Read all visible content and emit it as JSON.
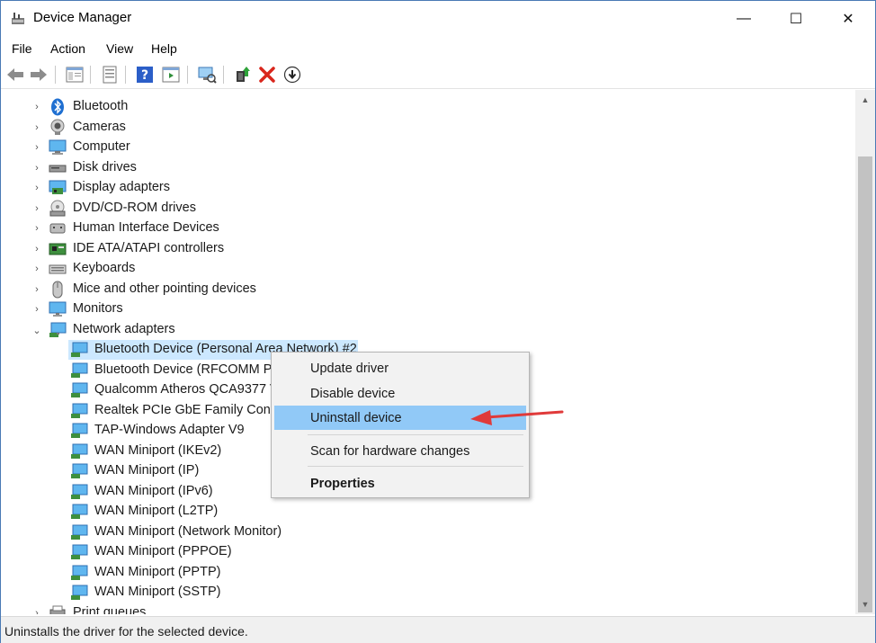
{
  "window": {
    "title": "Device Manager",
    "controls": [
      "—",
      "☐",
      "✕"
    ]
  },
  "menu": [
    "File",
    "Action",
    "View",
    "Help"
  ],
  "toolbar": {
    "icons": [
      "back-icon",
      "forward-icon",
      "show-hide-console-tree-icon",
      "properties-icon",
      "help-icon",
      "action-pane-icon",
      "scan-hardware-icon",
      "update-driver-icon",
      "uninstall-device-icon",
      "enable-device-icon"
    ],
    "uninstall_color": "#d9261c"
  },
  "tree": {
    "categories": [
      {
        "label": "Bluetooth",
        "icon": "bluetooth-icon"
      },
      {
        "label": "Cameras",
        "icon": "camera-icon"
      },
      {
        "label": "Computer",
        "icon": "computer-icon"
      },
      {
        "label": "Disk drives",
        "icon": "disk-drive-icon"
      },
      {
        "label": "Display adapters",
        "icon": "display-adapter-icon"
      },
      {
        "label": "DVD/CD-ROM drives",
        "icon": "dvd-drive-icon"
      },
      {
        "label": "Human Interface Devices",
        "icon": "hid-icon"
      },
      {
        "label": "IDE ATA/ATAPI controllers",
        "icon": "ide-controller-icon"
      },
      {
        "label": "Keyboards",
        "icon": "keyboard-icon"
      },
      {
        "label": "Mice and other pointing devices",
        "icon": "mouse-icon"
      },
      {
        "label": "Monitors",
        "icon": "monitor-icon"
      },
      {
        "label": "Network adapters",
        "icon": "network-adapter-icon",
        "expanded": true
      }
    ],
    "network_children": [
      "Bluetooth Device (Personal Area Network) #2",
      "Bluetooth Device (RFCOMM Pr",
      "Qualcomm Atheros QCA9377 V",
      "Realtek PCIe GbE Family Contro",
      "TAP-Windows Adapter V9",
      "WAN Miniport (IKEv2)",
      "WAN Miniport (IP)",
      "WAN Miniport (IPv6)",
      "WAN Miniport (L2TP)",
      "WAN Miniport (Network Monitor)",
      "WAN Miniport (PPPOE)",
      "WAN Miniport (PPTP)",
      "WAN Miniport (SSTP)"
    ],
    "after": "Print queues",
    "selected_color": "#cce8ff"
  },
  "context_menu": {
    "items": [
      "Update driver",
      "Disable device",
      "Uninstall device",
      "Scan for hardware changes",
      "Properties"
    ],
    "highlighted": "Uninstall device",
    "highlight_color": "#91c9f7",
    "pointer_arrow_color": "#e03a3a"
  },
  "status": {
    "text": "Uninstalls the driver for the selected device."
  }
}
